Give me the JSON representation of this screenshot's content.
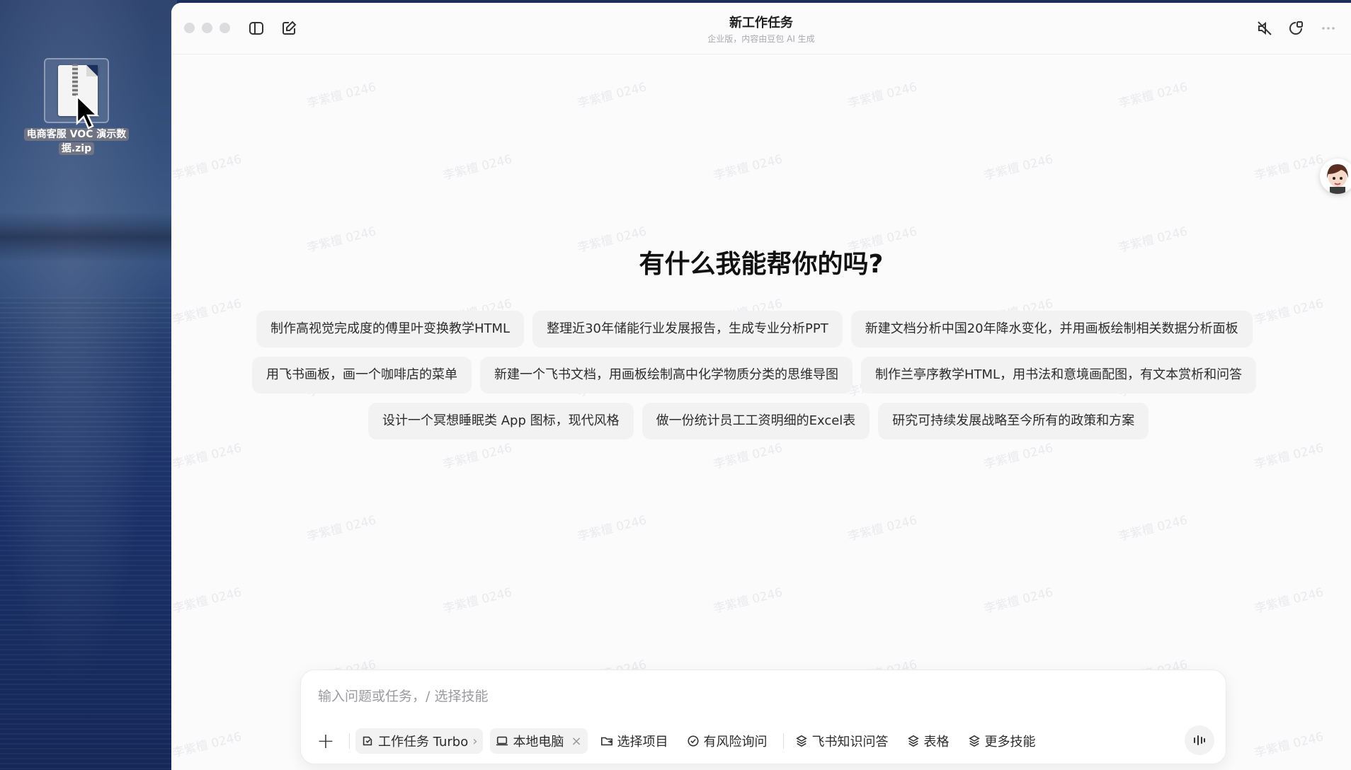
{
  "desktop": {
    "file": {
      "label_line1": "电商客服 VOC 演示数",
      "label_line2": "据.zip",
      "icon": "zip-archive-icon"
    }
  },
  "window": {
    "title": "新工作任务",
    "subtitle": "企业版，内容由豆包 AI 生成",
    "watermark": "李紫檀 0246"
  },
  "main": {
    "heading": "有什么我能帮你的吗?",
    "suggestions": [
      [
        "制作高视觉完成度的傅里叶变换教学HTML",
        "整理近30年储能行业发展报告，生成专业分析PPT",
        "新建文档分析中国20年降水变化，并用画板绘制相关数据分析面板"
      ],
      [
        "用飞书画板，画一个咖啡店的菜单",
        "新建一个飞书文档，用画板绘制高中化学物质分类的思维导图",
        "制作兰亭序教学HTML，用书法和意境画配图，有文本赏析和问答"
      ],
      [
        "设计一个冥想睡眠类 App 图标，现代风格",
        "做一份统计员工工资明细的Excel表",
        "研究可持续发展战略至今所有的政策和方案"
      ]
    ]
  },
  "composer": {
    "placeholder": "输入问题或任务，/ 选择技能",
    "mode": "工作任务 Turbo",
    "mode_arrow": "›",
    "location": "本地电脑",
    "location_close": "×",
    "select_project": "选择项目",
    "risk_inquiry": "有风险询问",
    "feishu_qa": "飞书知识问答",
    "table": "表格",
    "more_skills": "更多技能"
  }
}
